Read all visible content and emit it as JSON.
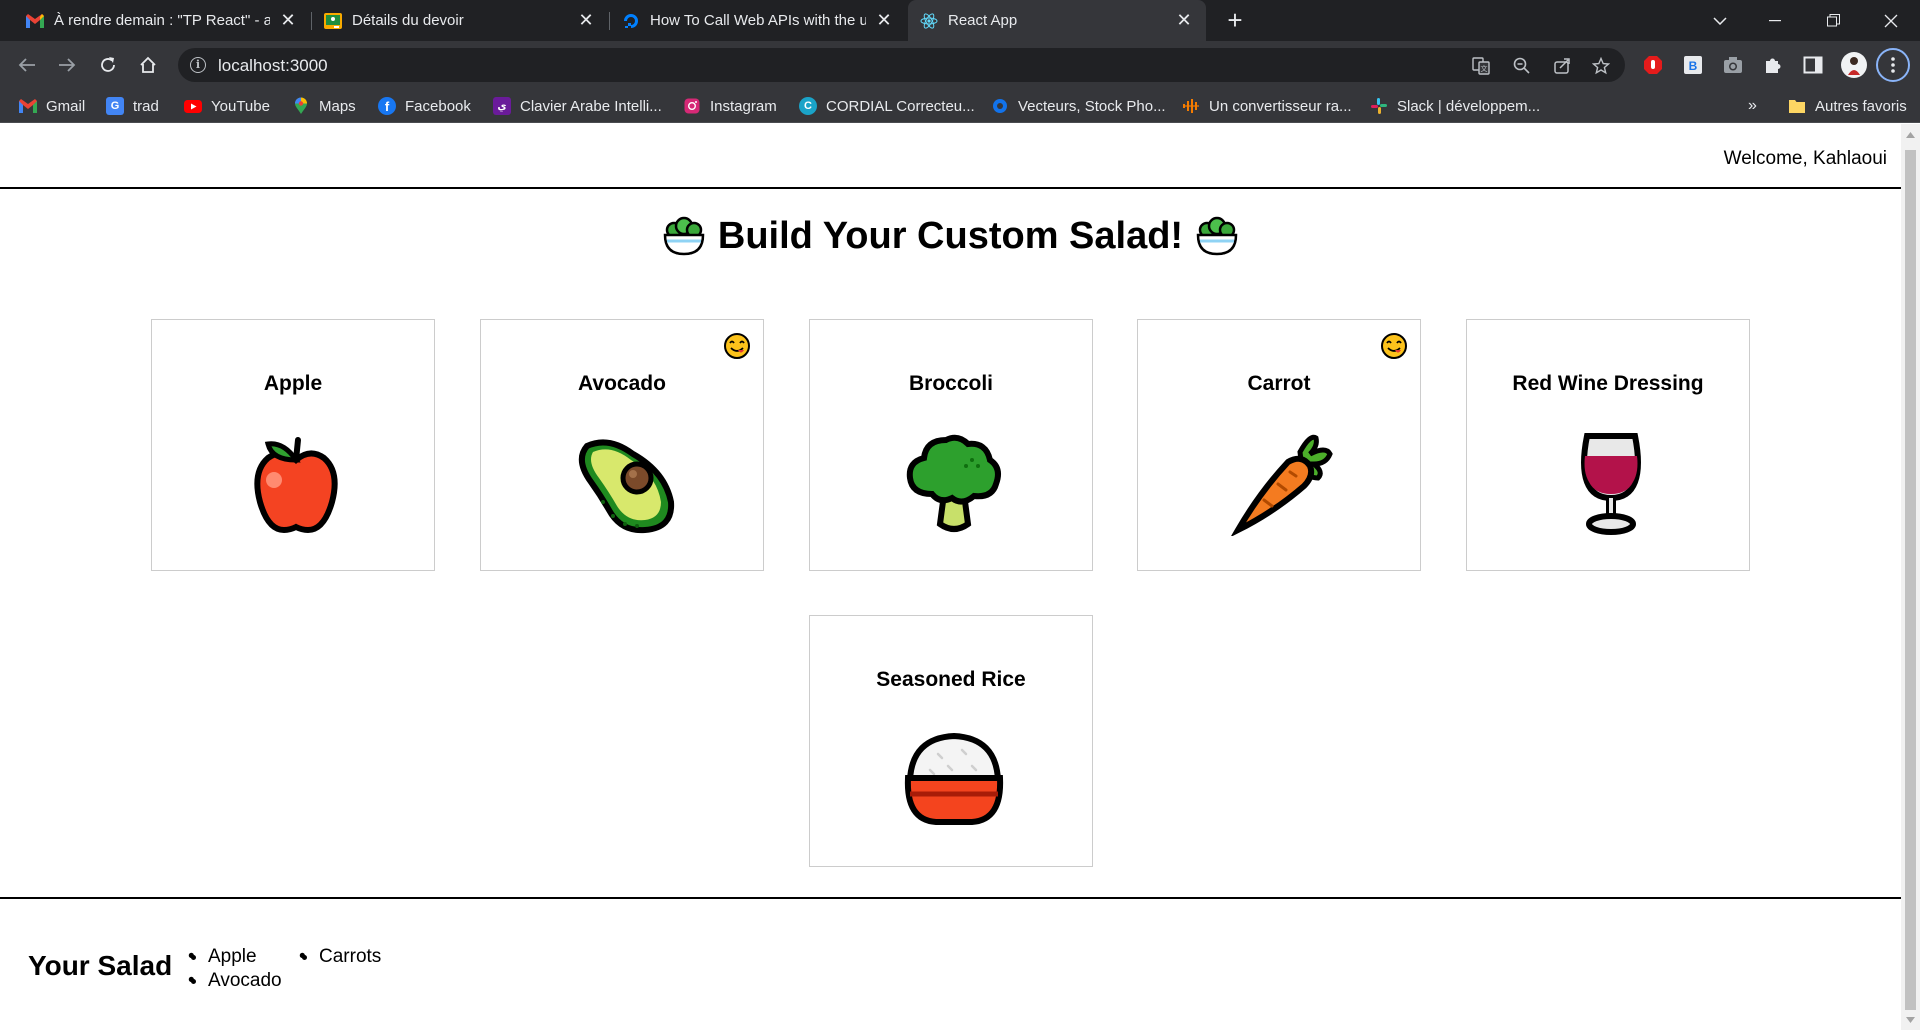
{
  "browser": {
    "tabs": [
      {
        "title": "À rendre demain : \"TP React\" - an",
        "icon": "gmail-icon"
      },
      {
        "title": "Détails du devoir",
        "icon": "classroom-icon"
      },
      {
        "title": "How To Call Web APIs with the us",
        "icon": "digitalocean-icon"
      },
      {
        "title": "React App",
        "icon": "react-icon"
      }
    ],
    "url": "localhost:3000",
    "bookmarks": [
      {
        "label": "Gmail",
        "icon": "gmail-icon"
      },
      {
        "label": "trad",
        "icon": "translate-icon"
      },
      {
        "label": "YouTube",
        "icon": "youtube-icon"
      },
      {
        "label": "Maps",
        "icon": "maps-icon"
      },
      {
        "label": "Facebook",
        "icon": "facebook-icon"
      },
      {
        "label": "Clavier Arabe Intelli...",
        "icon": "keyboard-icon"
      },
      {
        "label": "Instagram",
        "icon": "instagram-icon"
      },
      {
        "label": "CORDIAL Correcteu...",
        "icon": "cordial-icon"
      },
      {
        "label": "Vecteurs, Stock Pho...",
        "icon": "freepik-icon"
      },
      {
        "label": "Un convertisseur ra...",
        "icon": "audio-icon"
      },
      {
        "label": "Slack | développem...",
        "icon": "slack-icon"
      }
    ],
    "more_bookmarks": "»",
    "other_favorites": "Autres favoris"
  },
  "header": {
    "welcome": "Welcome, Kahlaoui"
  },
  "main": {
    "title": "Build Your Custom Salad!",
    "ingredients": [
      {
        "name": "Apple",
        "image": "apple-emoji",
        "favorite": false
      },
      {
        "name": "Avocado",
        "image": "avocado-emoji",
        "favorite": true
      },
      {
        "name": "Broccoli",
        "image": "broccoli-emoji",
        "favorite": false
      },
      {
        "name": "Carrot",
        "image": "carrot-emoji",
        "favorite": true
      },
      {
        "name": "Red Wine Dressing",
        "image": "wine-glass-emoji",
        "favorite": false
      },
      {
        "name": "Seasoned Rice",
        "image": "rice-bowl-emoji",
        "favorite": false
      }
    ]
  },
  "salad": {
    "title": "Your Salad",
    "items": [
      "Apple",
      "Avocado",
      "Carrots"
    ]
  },
  "colors": {
    "chrome_dark": "#202124",
    "chrome_toolbar": "#35363a",
    "chrome_text": "#e8eaed"
  }
}
